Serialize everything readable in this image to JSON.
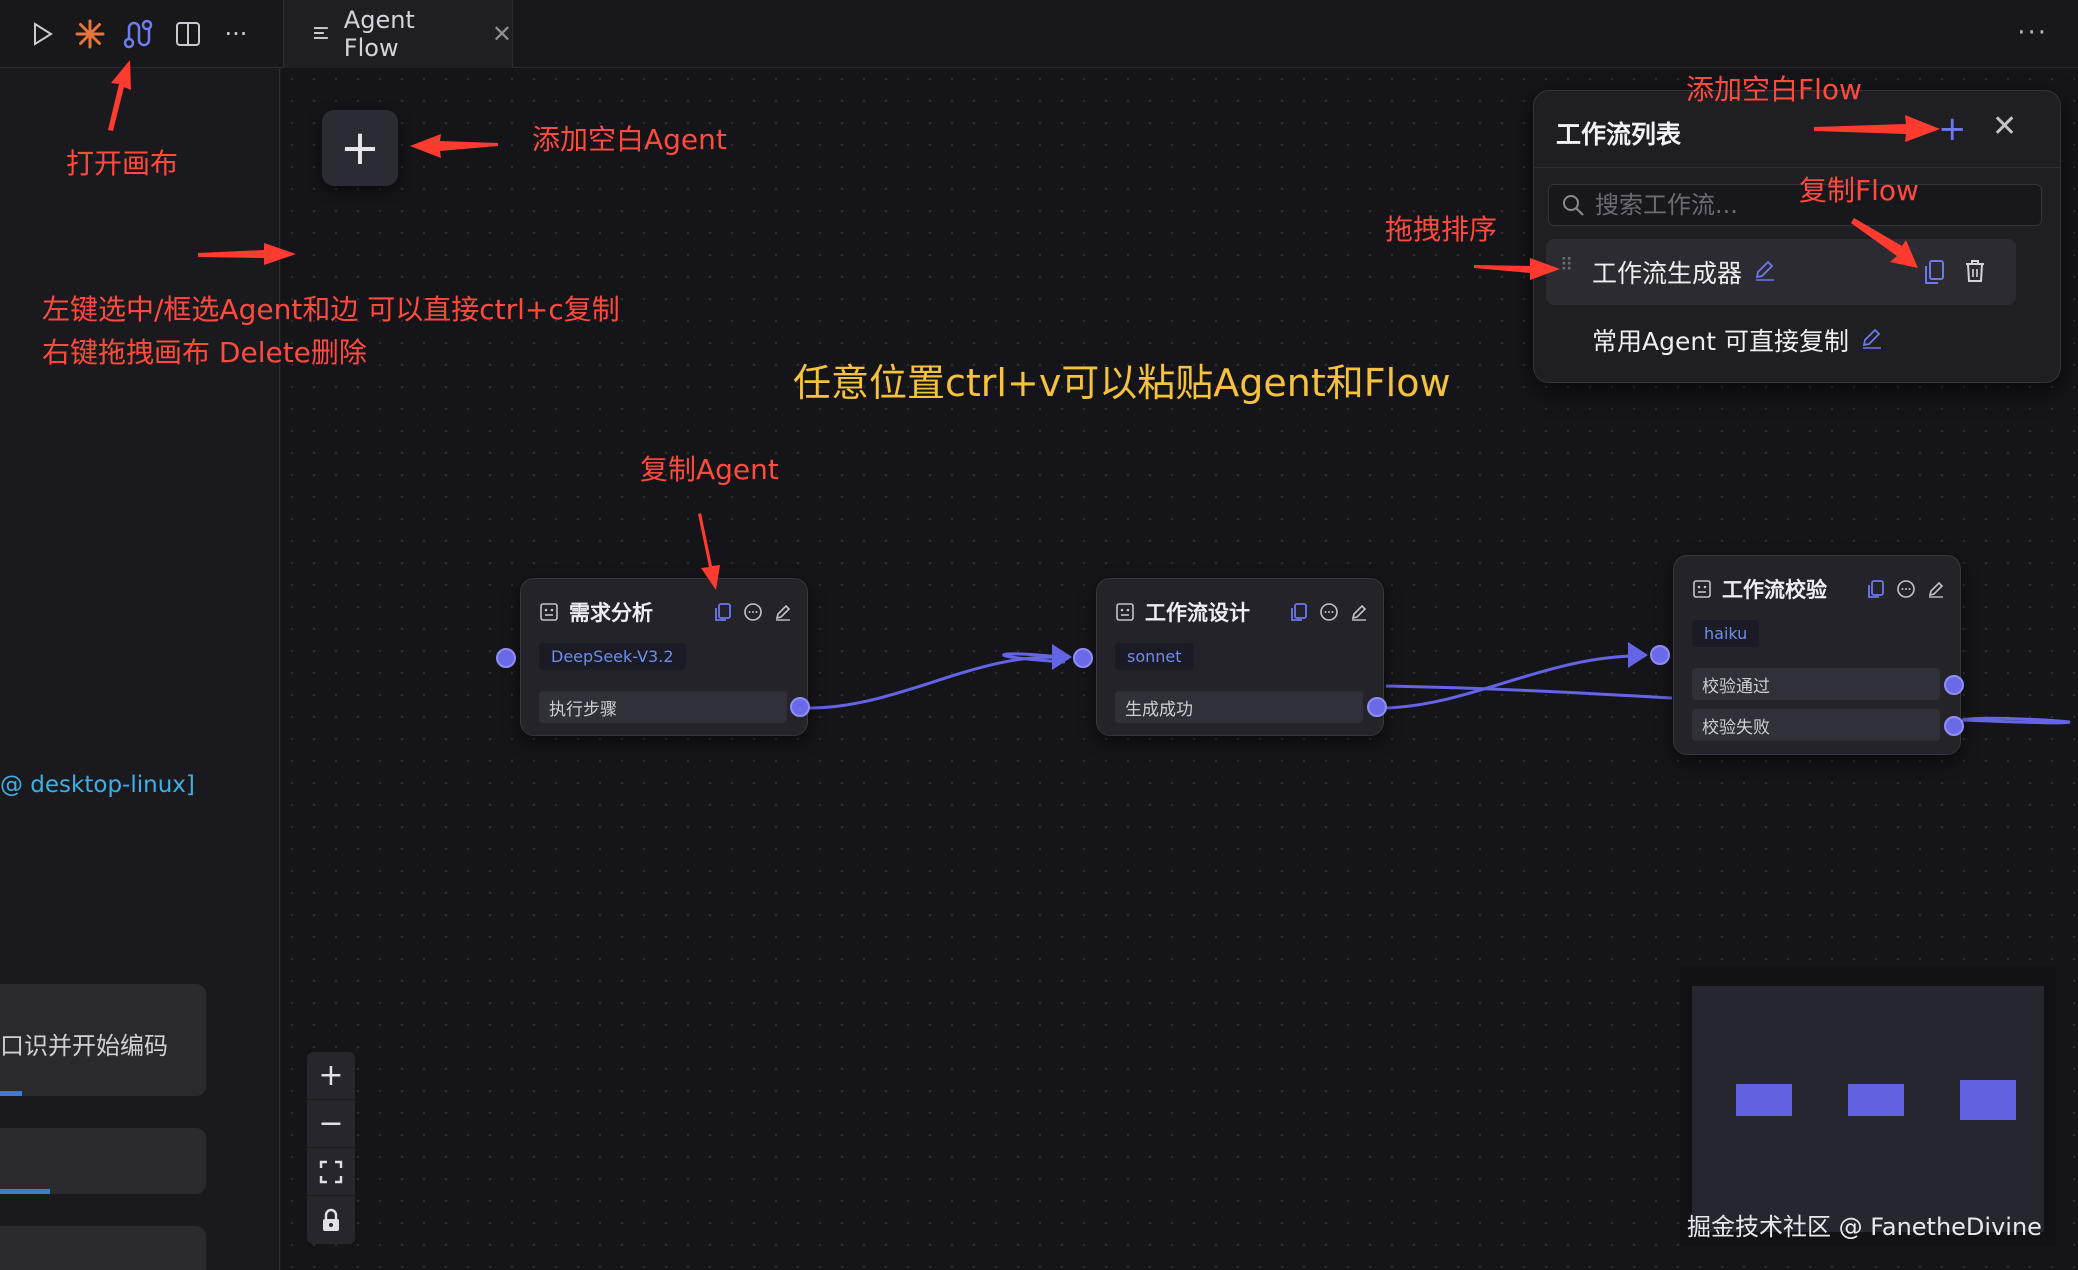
{
  "tab": {
    "title": "Agent Flow"
  },
  "left_panel": {
    "status_text": "@ desktop-linux]",
    "cards": [
      {
        "text": "口识并开始编码",
        "progress": 0.12
      },
      {
        "text": "",
        "progress": 0.25
      },
      {
        "text": "",
        "progress": 0
      }
    ]
  },
  "canvas": {
    "nodes": [
      {
        "title": "需求分析",
        "model": "DeepSeek-V3.2",
        "outputs": [
          "执行步骤"
        ]
      },
      {
        "title": "工作流设计",
        "model": "sonnet",
        "outputs": [
          "生成成功"
        ]
      },
      {
        "title": "工作流校验",
        "model": "haiku",
        "outputs": [
          "校验通过",
          "校验失败"
        ]
      }
    ]
  },
  "workflow_panel": {
    "title": "工作流列表",
    "search_placeholder": "搜索工作流...",
    "items": [
      {
        "name": "工作流生成器",
        "active": true
      },
      {
        "name": "常用Agent 可直接复制",
        "active": false
      }
    ]
  },
  "annotations": {
    "open_canvas": "打开画布",
    "add_blank_agent": "添加空白Agent",
    "select_copy": "左键选中/框选Agent和边 可以直接ctrl+c复制",
    "drag_delete": "右键拖拽画布 Delete删除",
    "add_blank_flow": "添加空白Flow",
    "copy_flow": "复制Flow",
    "drag_sort": "拖拽排序",
    "paste_anywhere": "任意位置ctrl+v可以粘贴Agent和Flow",
    "copy_agent": "复制Agent"
  },
  "watermark": "掘金技术社区 @ FanetheDivine",
  "colors": {
    "accent": "#6b6bef",
    "annotation": "#ff4a3d",
    "highlight": "#f5c23d"
  }
}
